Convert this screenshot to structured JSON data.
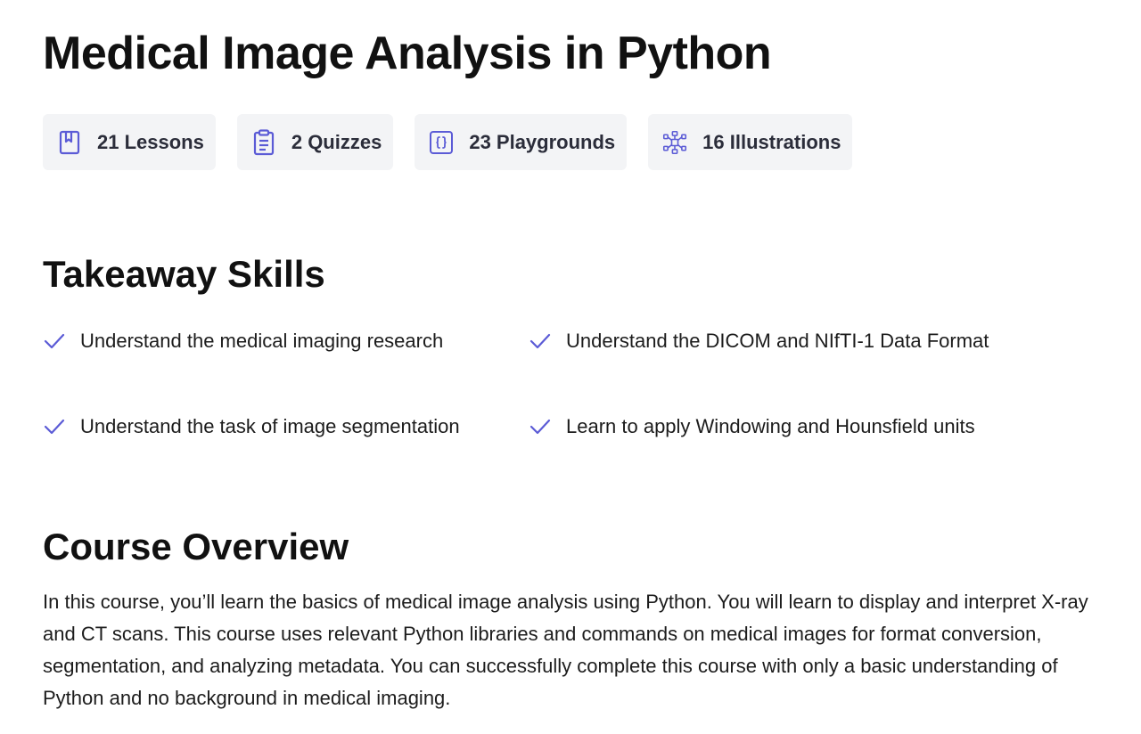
{
  "course": {
    "title": "Medical Image Analysis in Python"
  },
  "stats": [
    {
      "icon": "bookmark-book-icon",
      "label": "21 Lessons"
    },
    {
      "icon": "clipboard-icon",
      "label": "2 Quizzes"
    },
    {
      "icon": "code-braces-icon",
      "label": "23 Playgrounds"
    },
    {
      "icon": "network-icon",
      "label": "16 Illustrations"
    }
  ],
  "skills": {
    "heading": "Takeaway Skills",
    "items": [
      {
        "text": "Understand the medical imaging research"
      },
      {
        "text": "Understand the DICOM and NIfTI-1 Data Format"
      },
      {
        "text": "Understand the task of image segmentation"
      },
      {
        "text": "Learn to apply Windowing and Hounsfield units"
      }
    ]
  },
  "overview": {
    "heading": "Course Overview",
    "text": "In this course, you’ll learn the basics of medical image analysis using Python. You will learn to display and interpret X-ray and CT scans. This course uses relevant Python libraries and commands on medical images for format conversion, segmentation, and analyzing metadata. You can successfully complete this course with only a basic understanding of Python and no background in medical imaging."
  },
  "colors": {
    "accent": "#5b5bd6",
    "chip_background": "#f3f4f6",
    "text": "#111111"
  }
}
